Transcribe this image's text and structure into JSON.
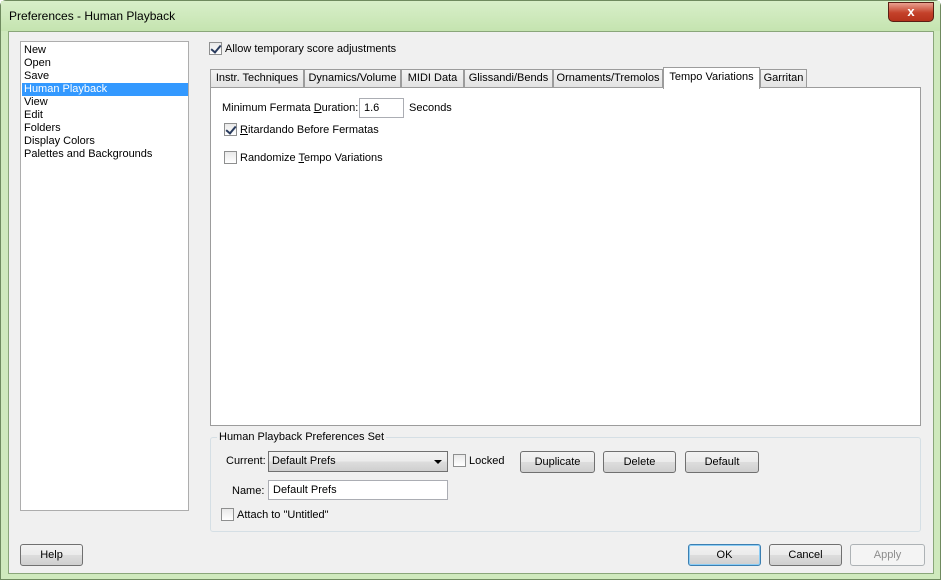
{
  "window": {
    "title": "Preferences - Human Playback",
    "close_glyph": "x"
  },
  "categories": [
    {
      "label": "New",
      "selected": false
    },
    {
      "label": "Open",
      "selected": false
    },
    {
      "label": "Save",
      "selected": false
    },
    {
      "label": "Human Playback",
      "selected": true
    },
    {
      "label": "View",
      "selected": false
    },
    {
      "label": "Edit",
      "selected": false
    },
    {
      "label": "Folders",
      "selected": false
    },
    {
      "label": "Display Colors",
      "selected": false
    },
    {
      "label": "Palettes and Backgrounds",
      "selected": false
    }
  ],
  "allow_temp": {
    "label": "Allow temporary score adjustments",
    "checked": true
  },
  "tabs": [
    {
      "label": "Instr. Techniques"
    },
    {
      "label": "Dynamics/Volume"
    },
    {
      "label": "MIDI Data"
    },
    {
      "label": "Glissandi/Bends"
    },
    {
      "label": "Ornaments/Tremolos"
    },
    {
      "label": "Tempo Variations",
      "active": true
    },
    {
      "label": "Garritan"
    }
  ],
  "tempo": {
    "fermata_label_pre": "Minimum Fermata ",
    "fermata_label_u": "D",
    "fermata_label_post": "uration:",
    "fermata_value": "1.6",
    "fermata_unit": "Seconds",
    "ritardando_u": "R",
    "ritardando_rest": "itardando Before Fermatas",
    "ritardando_checked": true,
    "randomize_pre": "Randomize ",
    "randomize_u": "T",
    "randomize_post": "empo Variations",
    "randomize_checked": false
  },
  "prefs_set": {
    "title": "Human Playback Preferences Set",
    "current_label": "Current:",
    "current_value": "Default Prefs",
    "locked_label": "Locked",
    "locked_checked": false,
    "duplicate_label": "Duplicate",
    "delete_label": "Delete",
    "default_label": "Default",
    "name_label": "Name:",
    "name_value": "Default Prefs",
    "attach_label": "Attach to \"Untitled\"",
    "attach_checked": false
  },
  "footer": {
    "help_label": "Help",
    "ok_label": "OK",
    "cancel_label": "Cancel",
    "apply_label": "Apply"
  }
}
